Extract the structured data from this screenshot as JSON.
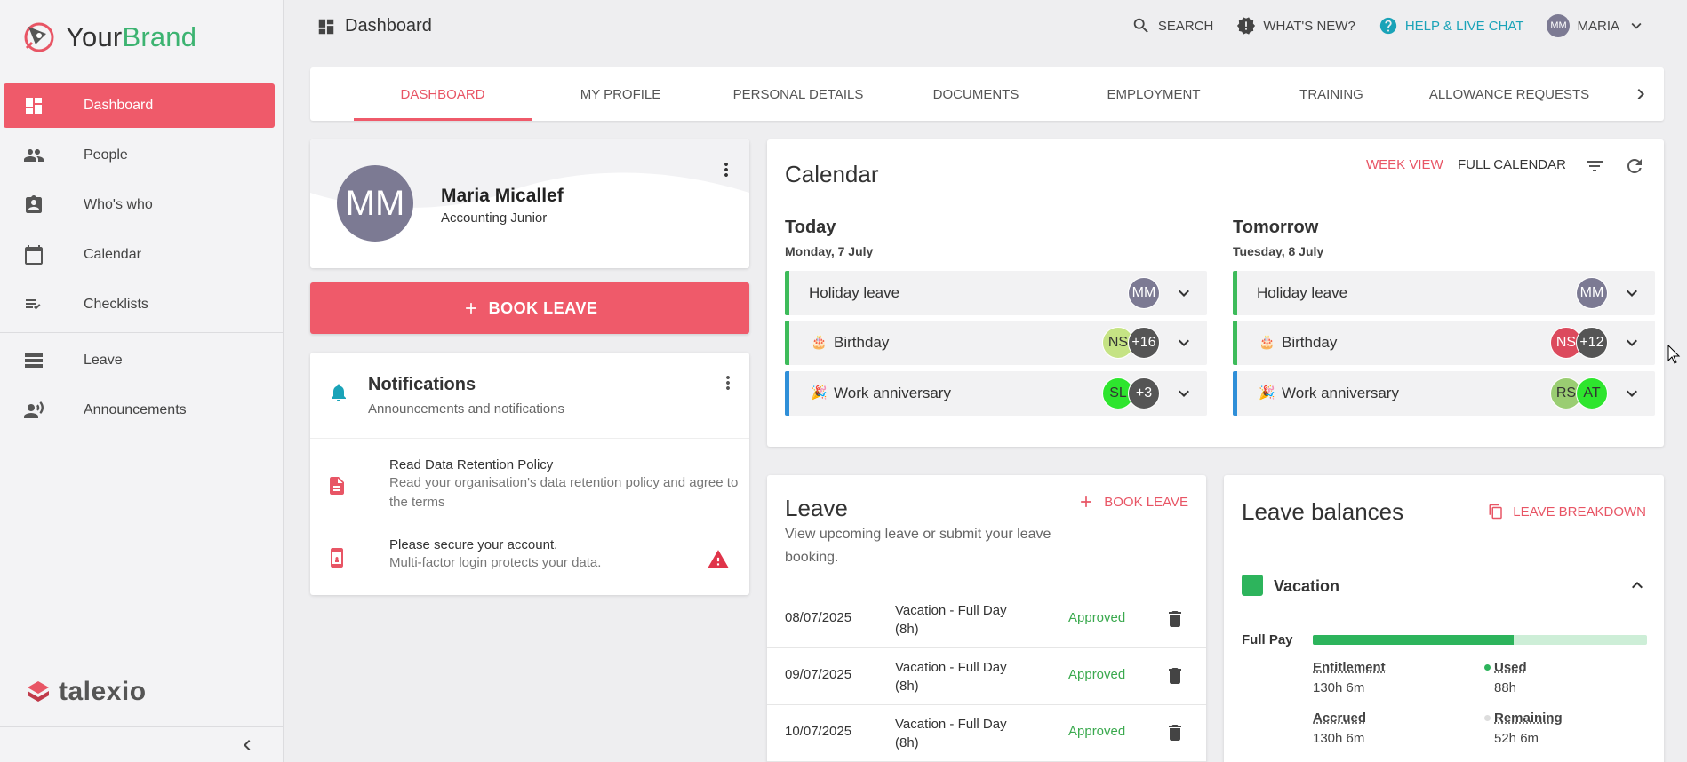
{
  "brand": {
    "name_part1": "Your",
    "name_part2": "Brand",
    "accent": "#3cb371"
  },
  "sidebar": {
    "items": [
      {
        "label": "Dashboard",
        "icon": "dashboard-icon",
        "active": true
      },
      {
        "label": "People",
        "icon": "people-icon"
      },
      {
        "label": "Who's who",
        "icon": "contact-badge-icon"
      },
      {
        "label": "Calendar",
        "icon": "calendar-icon"
      },
      {
        "label": "Checklists",
        "icon": "checklist-icon"
      },
      {
        "label": "Leave",
        "icon": "leave-icon"
      },
      {
        "label": "Announcements",
        "icon": "announcement-icon"
      }
    ],
    "powered_by": "talexio"
  },
  "header": {
    "title": "Dashboard",
    "search": "SEARCH",
    "whats_new": "WHAT'S NEW?",
    "help": "HELP & LIVE CHAT",
    "user_initials": "MM",
    "user_name": "MARIA"
  },
  "tabs": [
    "DASHBOARD",
    "MY PROFILE",
    "PERSONAL DETAILS",
    "DOCUMENTS",
    "EMPLOYMENT",
    "TRAINING",
    "ALLOWANCE REQUESTS"
  ],
  "profile": {
    "initials": "MM",
    "name": "Maria Micallef",
    "role": "Accounting Junior"
  },
  "book_leave": "BOOK LEAVE",
  "notifications": {
    "title": "Notifications",
    "subtitle": "Announcements and notifications",
    "items": [
      {
        "title": "Read Data Retention Policy",
        "desc": "Read your organisation's data retention policy and agree to the terms"
      },
      {
        "title": "Please secure your account.",
        "desc": "Multi-factor login protects your data."
      }
    ]
  },
  "calendar": {
    "title": "Calendar",
    "week_view": "WEEK VIEW",
    "full_calendar": "FULL CALENDAR",
    "today": {
      "heading": "Today",
      "date": "Monday, 7 July",
      "events": [
        {
          "label": "Holiday leave",
          "avatars": [
            "MM"
          ]
        },
        {
          "label": "Birthday",
          "emoji": "🎂",
          "avatars": [
            "NS",
            "+16"
          ]
        },
        {
          "label": "Work anniversary",
          "emoji": "🎉",
          "avatars": [
            "SL",
            "+3"
          ]
        }
      ]
    },
    "tomorrow": {
      "heading": "Tomorrow",
      "date": "Tuesday, 8 July",
      "events": [
        {
          "label": "Holiday leave",
          "avatars": [
            "MM"
          ]
        },
        {
          "label": "Birthday",
          "emoji": "🎂",
          "avatars": [
            "NS",
            "+12"
          ]
        },
        {
          "label": "Work anniversary",
          "emoji": "🎉",
          "avatars": [
            "RS",
            "AT"
          ]
        }
      ]
    }
  },
  "leave": {
    "title": "Leave",
    "subtitle": "View upcoming leave or submit your leave booking.",
    "book_label": "BOOK LEAVE",
    "rows": [
      {
        "date": "08/07/2025",
        "type": "Vacation - Full Day (8h)",
        "status": "Approved"
      },
      {
        "date": "09/07/2025",
        "type": "Vacation - Full Day (8h)",
        "status": "Approved"
      },
      {
        "date": "10/07/2025",
        "type": "Vacation - Full Day (8h)",
        "status": "Approved"
      }
    ]
  },
  "balances": {
    "title": "Leave balances",
    "breakdown": "LEAVE BREAKDOWN",
    "category": "Vacation",
    "pay_label": "Full Pay",
    "used_fraction": 0.6,
    "entitlement_label": "Entitlement",
    "entitlement": "130h 6m",
    "used_label": "Used",
    "used": "88h",
    "accrued_label": "Accrued",
    "accrued": "130h 6m",
    "remaining_label": "Remaining",
    "remaining": "52h 6m"
  },
  "colors": {
    "primary": "#ef5a6a",
    "success": "#2db45c",
    "help": "#1aa3b8",
    "event_blue": "#2f8fd8"
  }
}
